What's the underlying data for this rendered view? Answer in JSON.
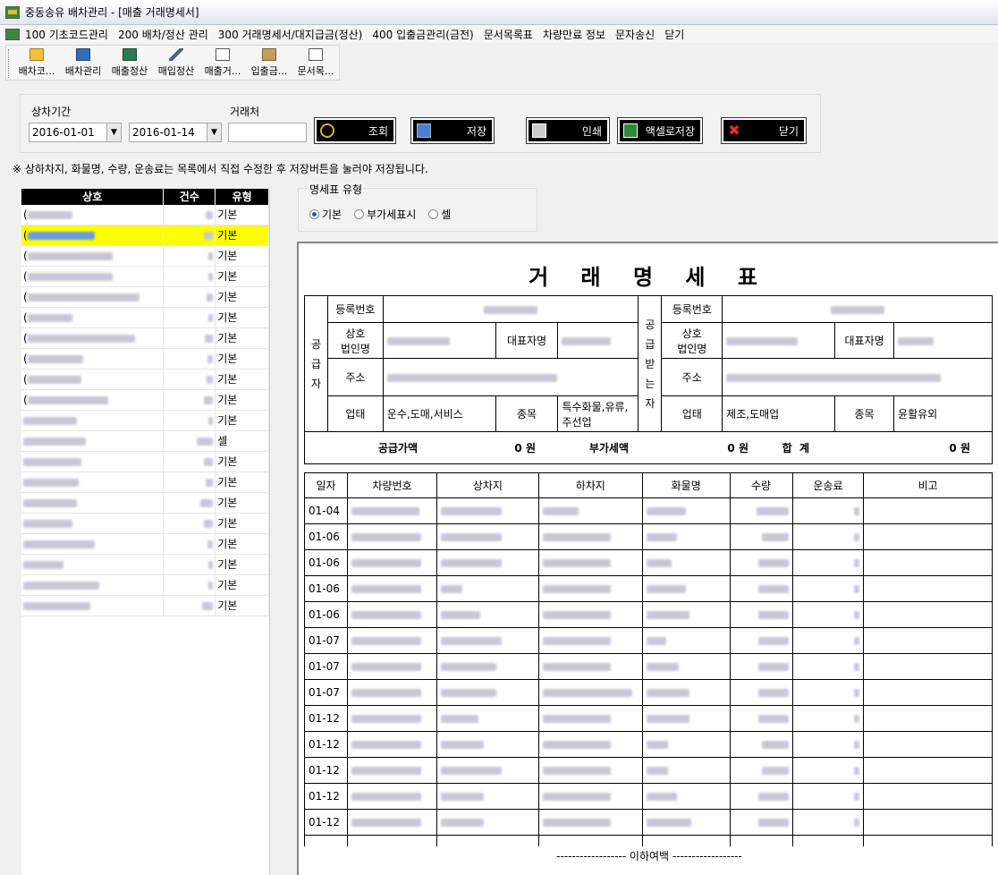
{
  "window": {
    "title": "중동송유 배차관리 - [매출 거래명세서]"
  },
  "menu": [
    "100 기초코드관리",
    "200 배차/정산 관리",
    "300 거래명세서/대지급금(정산)",
    "400 입출금관리(금전)",
    "문서목록표",
    "차량만료 정보",
    "문자송신",
    "닫기"
  ],
  "toolbar": [
    {
      "label": "배차코...",
      "icon": "folder-icon"
    },
    {
      "label": "배차관리",
      "icon": "truck-icon"
    },
    {
      "label": "매출정산",
      "icon": "calculator-icon"
    },
    {
      "label": "매입정산",
      "icon": "pen-icon"
    },
    {
      "label": "매출거...",
      "icon": "document-icon"
    },
    {
      "label": "입출금...",
      "icon": "money-icon"
    },
    {
      "label": "문서목...",
      "icon": "list-icon"
    }
  ],
  "filter": {
    "period_label": "상차기간",
    "date_from": "2016-01-01",
    "date_to": "2016-01-14",
    "client_label": "거래처",
    "client_value": "",
    "search_button": "조회",
    "save_button": "저장",
    "print_button": "인쇄",
    "excel_button": "액셀로저장",
    "close_button": "닫기"
  },
  "notice": "※ 상하차지, 화물명, 수량, 운송료는 목록에서 직접 수정한 후 저장버튼을 눌러야 저장됩니다.",
  "company_list": {
    "headers": [
      "상호",
      "건수",
      "유형"
    ],
    "rows": [
      {
        "prefix": "(",
        "type": "기본"
      },
      {
        "prefix": "(",
        "type": "기본"
      },
      {
        "prefix": "(",
        "type": "기본"
      },
      {
        "prefix": "(",
        "type": "기본"
      },
      {
        "prefix": "(",
        "type": "기본"
      },
      {
        "prefix": "(",
        "type": "기본"
      },
      {
        "prefix": "(",
        "type": "기본"
      },
      {
        "prefix": "(",
        "type": "기본"
      },
      {
        "prefix": "(",
        "type": "기본"
      },
      {
        "prefix": "(",
        "type": "기본"
      },
      {
        "prefix": "",
        "type": "기본"
      },
      {
        "prefix": "",
        "type": "셀"
      },
      {
        "prefix": "",
        "type": "기본"
      },
      {
        "prefix": "",
        "type": "기본"
      },
      {
        "prefix": "",
        "type": "기본"
      },
      {
        "prefix": "",
        "type": "기본"
      },
      {
        "prefix": "",
        "type": "기본"
      },
      {
        "prefix": "",
        "type": "기본"
      },
      {
        "prefix": "",
        "type": "기본"
      },
      {
        "prefix": "",
        "type": "기본"
      }
    ],
    "selected_index": 1
  },
  "statement_type": {
    "legend": "명세표 유형",
    "options": [
      "기본",
      "부가세표시",
      "셀"
    ],
    "selected": "기본"
  },
  "invoice": {
    "title": "거 래 명 세 표",
    "supplier_side": "공\n급\n자",
    "receiver_side": "공\n급\n받\n는\n자",
    "reg_no_label": "등록번호",
    "name_label": "상호\n법인명",
    "rep_label": "대표자명",
    "address_label": "주소",
    "business_label": "업태",
    "item_label": "종목",
    "supplier_business": "운수,도매,서비스",
    "supplier_item": "특수화물,유류,\n주선업",
    "receiver_business": "제조,도매업",
    "receiver_item": "윤활유외",
    "supply_amount_label": "공급가액",
    "supply_amount": "0 원",
    "vat_label": "부가세액",
    "vat_amount": "0 원",
    "total_label": "합  계",
    "total_amount": "0 원",
    "columns": [
      "일자",
      "차량번호",
      "상차지",
      "하차지",
      "화물명",
      "수량",
      "운송료",
      "비고"
    ],
    "dates": [
      "01-04",
      "01-06",
      "01-06",
      "01-06",
      "01-06",
      "01-07",
      "01-07",
      "01-07",
      "01-12",
      "01-12",
      "01-12",
      "01-12",
      "01-12"
    ],
    "end_text": "------------------ 이하여백 ------------------"
  }
}
